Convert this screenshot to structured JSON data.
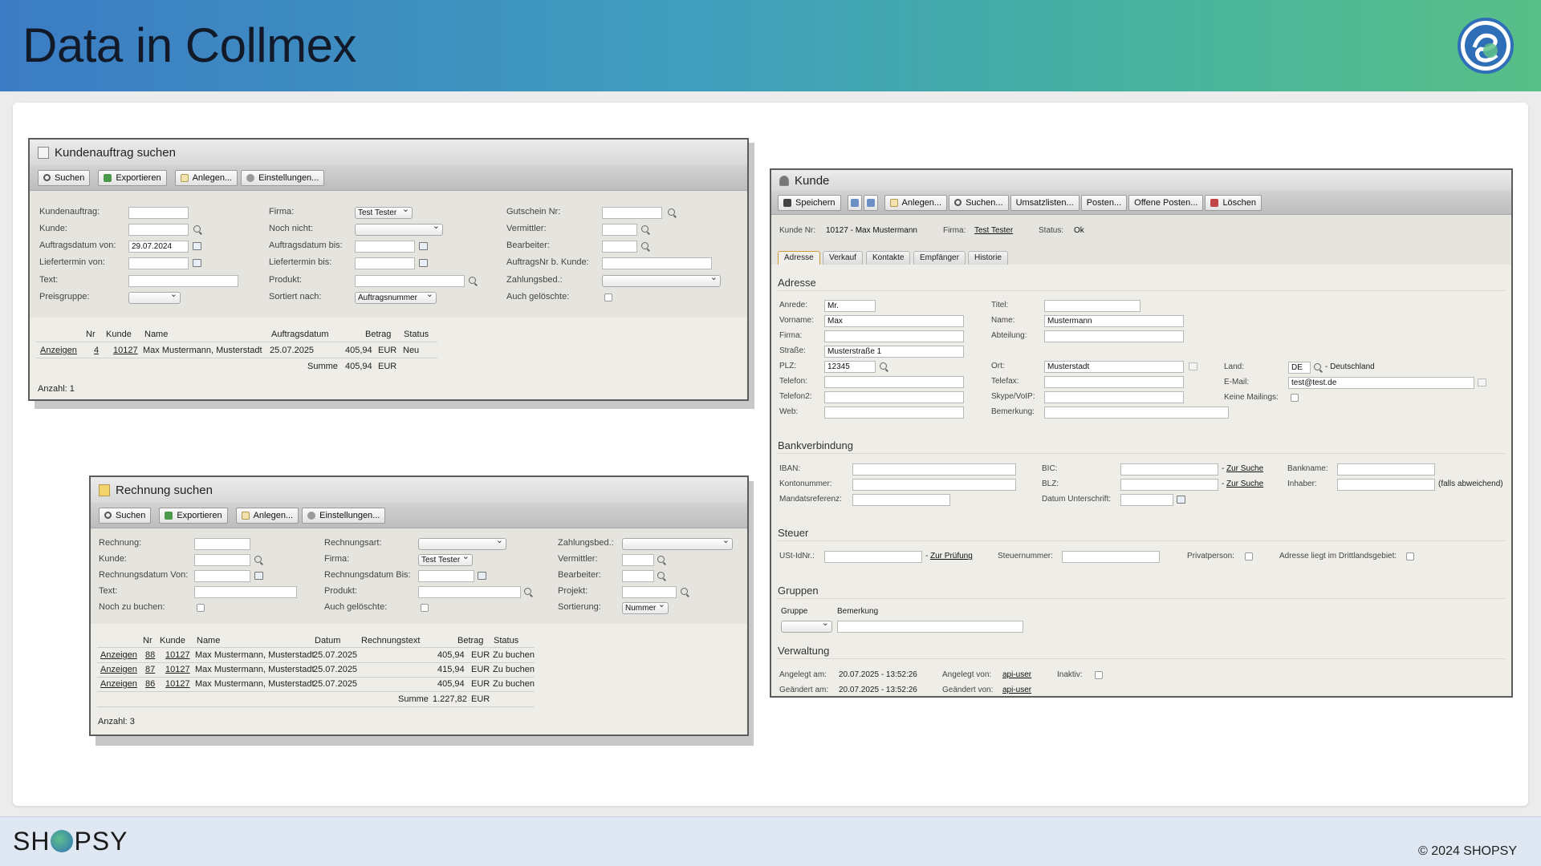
{
  "slide": {
    "title": "Data in Collmex",
    "brand": "SHOPSY",
    "copyright": "© 2024 SHOPSY"
  },
  "auftrag": {
    "title": "Kundenauftrag suchen",
    "toolbar": [
      "Suchen",
      "Exportieren",
      "Anlegen...",
      "Einstellungen..."
    ],
    "labels": {
      "kundenauftrag": "Kundenauftrag:",
      "kunde": "Kunde:",
      "auftragsdatum_von": "Auftragsdatum von:",
      "liefertermin_von": "Liefertermin von:",
      "text": "Text:",
      "preisgruppe": "Preisgruppe:",
      "firma": "Firma:",
      "noch_nicht": "Noch nicht:",
      "auftragsdatum_bis": "Auftragsdatum bis:",
      "liefertermin_bis": "Liefertermin bis:",
      "produkt": "Produkt:",
      "sortiert_nach": "Sortiert nach:",
      "gutschein": "Gutschein Nr:",
      "vermittler": "Vermittler:",
      "bearbeiter": "Bearbeiter:",
      "auftragsnr_kunde": "AuftragsNr b. Kunde:",
      "zahlungsbed": "Zahlungsbed.:",
      "auch_geloeschte": "Auch gelöschte:"
    },
    "values": {
      "auftragsdatum_von": "29.07.2024",
      "firma": "Test Tester",
      "sortiert_nach": "Auftragsnummer"
    },
    "columns": [
      "Nr",
      "Kunde",
      "Name",
      "Auftragsdatum",
      "Betrag",
      "Status"
    ],
    "rows": [
      {
        "action": "Anzeigen",
        "nr": "4",
        "kunde": "10127",
        "name": "Max Mustermann, Musterstadt",
        "datum": "25.07.2025",
        "betrag": "405,94",
        "cur": "EUR",
        "status": "Neu"
      }
    ],
    "summe_label": "Summe",
    "summe": "405,94",
    "summe_cur": "EUR",
    "count": "Anzahl: 1"
  },
  "rechnung": {
    "title": "Rechnung suchen",
    "toolbar": [
      "Suchen",
      "Exportieren",
      "Anlegen...",
      "Einstellungen..."
    ],
    "labels": {
      "rechnung": "Rechnung:",
      "kunde": "Kunde:",
      "rd_von": "Rechnungsdatum Von:",
      "text": "Text:",
      "noch_zu_buchen": "Noch zu buchen:",
      "rechnungsart": "Rechnungsart:",
      "firma": "Firma:",
      "rd_bis": "Rechnungsdatum Bis:",
      "produkt": "Produkt:",
      "auch_geloeschte": "Auch gelöschte:",
      "zahlungsbed": "Zahlungsbed.:",
      "vermittler": "Vermittler:",
      "bearbeiter": "Bearbeiter:",
      "projekt": "Projekt:",
      "sortierung": "Sortierung:"
    },
    "values": {
      "firma": "Test Tester",
      "sortierung": "Nummer"
    },
    "columns": [
      "Nr",
      "Kunde",
      "Name",
      "Datum",
      "Rechnungstext",
      "Betrag",
      "Status"
    ],
    "rows": [
      {
        "action": "Anzeigen",
        "nr": "88",
        "kunde": "10127",
        "name": "Max Mustermann, Musterstadt",
        "datum": "25.07.2025",
        "betrag": "405,94",
        "cur": "EUR",
        "status": "Zu buchen"
      },
      {
        "action": "Anzeigen",
        "nr": "87",
        "kunde": "10127",
        "name": "Max Mustermann, Musterstadt",
        "datum": "25.07.2025",
        "betrag": "415,94",
        "cur": "EUR",
        "status": "Zu buchen"
      },
      {
        "action": "Anzeigen",
        "nr": "86",
        "kunde": "10127",
        "name": "Max Mustermann, Musterstadt",
        "datum": "25.07.2025",
        "betrag": "405,94",
        "cur": "EUR",
        "status": "Zu buchen"
      }
    ],
    "summe_label": "Summe",
    "summe": "1.227,82",
    "summe_cur": "EUR",
    "count": "Anzahl: 3"
  },
  "kunde": {
    "title": "Kunde",
    "toolbar": [
      "Speichern",
      "Anlegen...",
      "Suchen...",
      "Umsatzlisten...",
      "Posten...",
      "Offene Posten...",
      "Löschen"
    ],
    "info": {
      "nr_label": "Kunde Nr:",
      "nr": "10127 - Max Mustermann",
      "firma_label": "Firma:",
      "firma": "Test Tester",
      "status_label": "Status:",
      "status": "Ok"
    },
    "tabs": [
      "Adresse",
      "Verkauf",
      "Kontakte",
      "Empfänger",
      "Historie"
    ],
    "adresse": {
      "title": "Adresse",
      "anrede_l": "Anrede:",
      "anrede": "Mr.",
      "vorname_l": "Vorname:",
      "vorname": "Max",
      "firma_l": "Firma:",
      "strasse_l": "Straße:",
      "strasse": "Musterstraße 1",
      "plz_l": "PLZ:",
      "plz": "12345",
      "telefon_l": "Telefon:",
      "telefon2_l": "Telefon2:",
      "web_l": "Web:",
      "titel_l": "Titel:",
      "name_l": "Name:",
      "name": "Mustermann",
      "abteilung_l": "Abteilung:",
      "ort_l": "Ort:",
      "ort": "Musterstadt",
      "telefax_l": "Telefax:",
      "skype_l": "Skype/VoIP:",
      "bemerkung_l": "Bemerkung:",
      "land_l": "Land:",
      "land": "DE",
      "land_name": "- Deutschland",
      "email_l": "E-Mail:",
      "email": "test@test.de",
      "mailings_l": "Keine Mailings:"
    },
    "bank": {
      "title": "Bankverbindung",
      "iban_l": "IBAN:",
      "konto_l": "Kontonummer:",
      "mandat_l": "Mandatsreferenz:",
      "bic_l": "BIC:",
      "blz_l": "BLZ:",
      "datum_l": "Datum Unterschrift:",
      "zursuche": "Zur Suche",
      "bankname_l": "Bankname:",
      "inhaber_l": "Inhaber:",
      "abweichend": "(falls abweichend)"
    },
    "steuer": {
      "title": "Steuer",
      "ust_l": "USt-IdNr.:",
      "zurpruefung": "Zur Prüfung",
      "steuernr_l": "Steuernummer:",
      "privat_l": "Privatperson:",
      "dritt_l": "Adresse liegt im Drittlandsgebiet:"
    },
    "gruppen": {
      "title": "Gruppen",
      "gruppe_l": "Gruppe",
      "bemerkung_l": "Bemerkung"
    },
    "verwaltung": {
      "title": "Verwaltung",
      "angelegt_am_l": "Angelegt am:",
      "angelegt_am": "20.07.2025 - 13:52:26",
      "geaendert_am_l": "Geändert am:",
      "geaendert_am": "20.07.2025 - 13:52:26",
      "angelegt_von_l": "Angelegt von:",
      "angelegt_von": "api-user",
      "geaendert_von_l": "Geändert von:",
      "geaendert_von": "api-user",
      "inaktiv_l": "Inaktiv:"
    }
  }
}
